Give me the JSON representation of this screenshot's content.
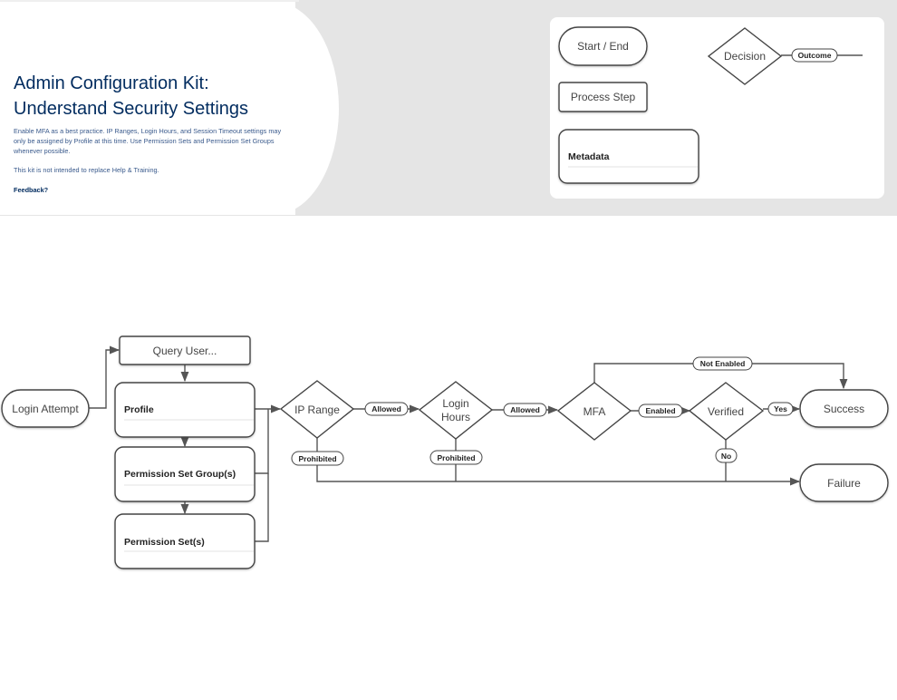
{
  "banner": {
    "title_line1": "Admin Configuration Kit:",
    "title_line2": "Understand Security Settings",
    "description": "Enable MFA as a best practice. IP Ranges, Login Hours, and Session Timeout settings may only be assigned by Profile at this time. Use Permission Sets and Permission Set Groups whenever possible.",
    "note": "This kit is not intended to replace Help & Training.",
    "feedback_link": "Feedback?",
    "title_color": "#032d60"
  },
  "legend": {
    "start_end": "Start / End",
    "process_step": "Process Step",
    "metadata": "Metadata",
    "decision": "Decision",
    "outcome": "Outcome"
  },
  "flow": {
    "nodes": {
      "login_attempt": "Login Attempt",
      "query_user": "Query User...",
      "profile": "Profile",
      "permission_set_groups": "Permission Set Group(s)",
      "permission_sets": "Permission Set(s)",
      "ip_range": "IP Range",
      "login_hours_1": "Login",
      "login_hours_2": "Hours",
      "mfa": "MFA",
      "verified": "Verified",
      "success": "Success",
      "failure": "Failure"
    },
    "edge_labels": {
      "ip_allowed": "Allowed",
      "hours_allowed": "Allowed",
      "ip_prohibited": "Prohibited",
      "hours_prohibited": "Prohibited",
      "mfa_enabled": "Enabled",
      "mfa_not_enabled": "Not Enabled",
      "verified_yes": "Yes",
      "verified_no": "No"
    }
  }
}
